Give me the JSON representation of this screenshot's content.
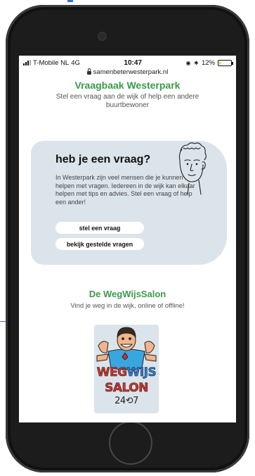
{
  "status_bar": {
    "carrier": "T-Mobile NL",
    "network": "4G",
    "time": "10:47",
    "battery": "12%",
    "battery_level": 0.12
  },
  "browser": {
    "url": "samenbeterwesterpark.nl"
  },
  "header": {
    "title": "Vraagbaak Westerpark",
    "subtitle": "Stel een vraag aan de wijk of help een andere buurtbewoner"
  },
  "question_card": {
    "heading": "heb je een vraag?",
    "body": "In Westerpark zijn veel mensen die je kunnen helpen met vragen. Iedereen in de wijk kan elkaar helpen met tips en advies. Stel een vraag of help een ander!",
    "ask_button": "stel een vraag",
    "view_button": "bekijk gestelde vragen"
  },
  "salon": {
    "title": "De WegWijsSalon",
    "subtitle": "Vind je weg in de wijk, online of offline!",
    "logo_text_top_a": "WEG",
    "logo_text_top_b": "WIJS",
    "logo_text_mid": "SALON",
    "logo_text_bottom": "24⟲7"
  },
  "colors": {
    "accent_green": "#3a9a4a",
    "card_bg": "#dbe4ea",
    "phone_body": "#1c1c1c"
  }
}
